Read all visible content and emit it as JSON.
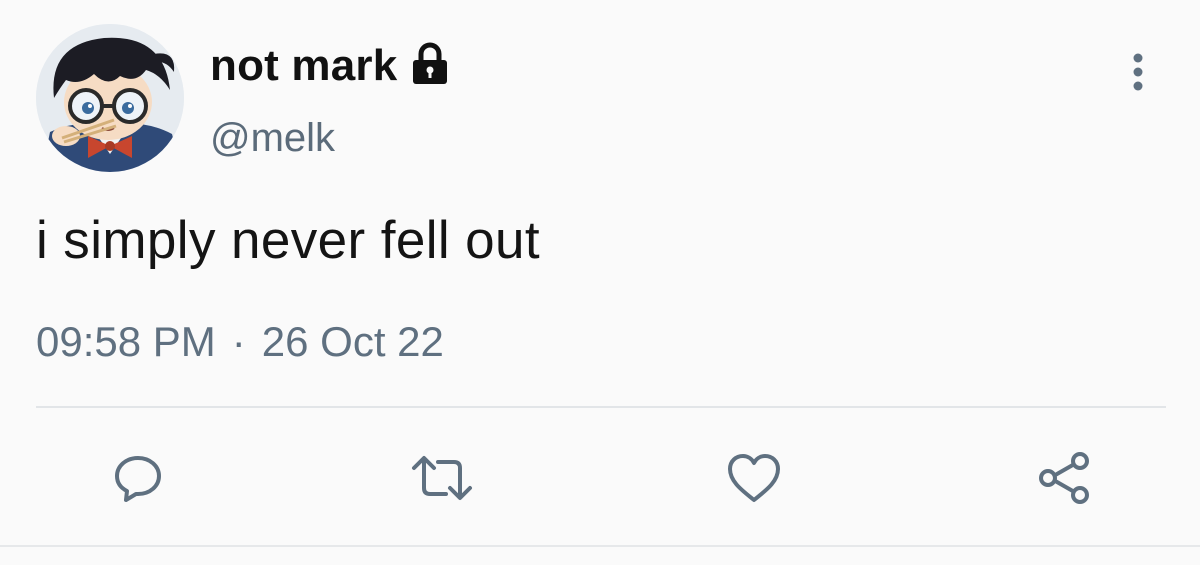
{
  "author": {
    "display_name": "not mark",
    "handle": "@melk",
    "avatar_icon": "anime-boy-with-glasses-avatar",
    "protected_icon": "lock-icon"
  },
  "tweet": {
    "text": "i simply never fell out",
    "time": "09:58 PM",
    "separator": "·",
    "date": "26 Oct 22"
  },
  "actions": {
    "more_icon": "vertical-dots-icon",
    "reply_icon": "reply-icon",
    "retweet_icon": "retweet-icon",
    "like_icon": "heart-icon",
    "share_icon": "share-icon"
  },
  "colors": {
    "text_primary": "#111111",
    "text_secondary": "#5f7080",
    "icon_gray": "#5f7080",
    "background": "#fafafa",
    "divider": "#e2e5e8"
  }
}
